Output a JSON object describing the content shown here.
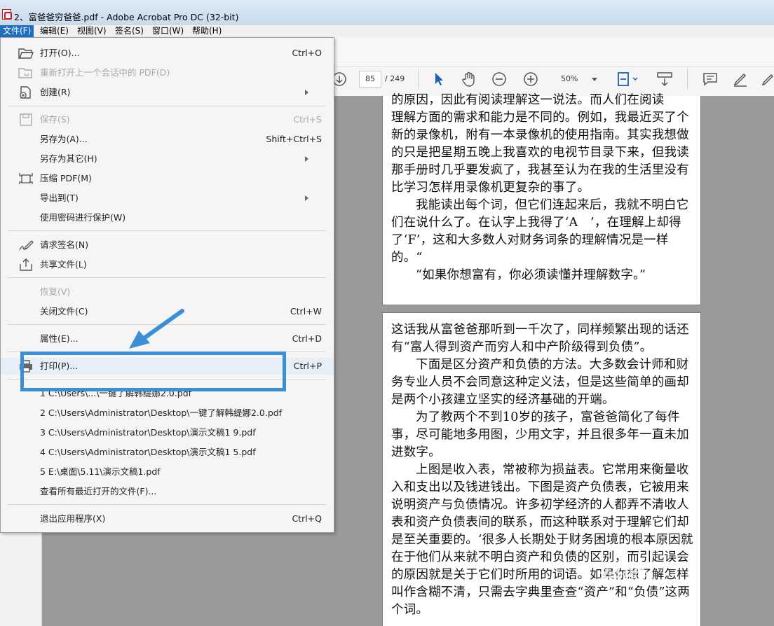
{
  "window": {
    "title": "2、富爸爸穷爸爸.pdf - Adobe Acrobat Pro DC (32-bit)"
  },
  "menubar": [
    "文件(F)",
    "编辑(E)",
    "视图(V)",
    "签名(S)",
    "窗口(W)",
    "帮助(H)"
  ],
  "toolbar": {
    "page_current": "85",
    "page_total": "/ 249",
    "zoom": "50%"
  },
  "file_menu": {
    "open": {
      "label": "打开(O)...",
      "shortcut": "Ctrl+O"
    },
    "reopen": {
      "label": "重新打开上一个会话中的 PDF(D)"
    },
    "create": {
      "label": "创建(R)"
    },
    "save": {
      "label": "保存(S)",
      "shortcut": "Ctrl+S"
    },
    "save_as": {
      "label": "另存为(A)...",
      "shortcut": "Shift+Ctrl+S"
    },
    "save_as_other": {
      "label": "另存为其它(H)"
    },
    "compress": {
      "label": "压缩 PDF(M)"
    },
    "export": {
      "label": "导出到(T)"
    },
    "protect": {
      "label": "使用密码进行保护(W)"
    },
    "request_sign": {
      "label": "请求签名(N)"
    },
    "share": {
      "label": "共享文件(L)"
    },
    "revert": {
      "label": "恢复(V)"
    },
    "close": {
      "label": "关闭文件(C)",
      "shortcut": "Ctrl+W"
    },
    "properties": {
      "label": "属性(E)...",
      "shortcut": "Ctrl+D"
    },
    "print": {
      "label": "打印(P)...",
      "shortcut": "Ctrl+P"
    },
    "recent": [
      "1 C:\\Users\\...\\一键了解韩缇娜2.0.pdf",
      "2 C:\\Users\\Administrator\\Desktop\\一键了解韩缇娜2.0.pdf",
      "3 C:\\Users\\Administrator\\Desktop\\演示文稿1 9.pdf",
      "4 C:\\Users\\Administrator\\Desktop\\演示文稿1 5.pdf",
      "5 E:\\桌面\\5.11\\演示文稿1.pdf"
    ],
    "view_all_recent": {
      "label": "查看所有最近打开的文件(F)..."
    },
    "exit": {
      "label": "退出应用程序(X)",
      "shortcut": "Ctrl+Q"
    }
  },
  "doc": {
    "page1": [
      "的原因，因此有阅读理解这一说法。而人们在阅读",
      "理解方面的需求和能力是不同的。例如，我最近买了个新的录像机，附有一本录像机的使用指南。其实我想做的只是把星期五晚上我喜欢的电视节目录下来，但我读那手册时几乎要发疯了，我甚至认为在我的生活里没有比学习怎样用录像机更复杂的事了。",
      "我能读出每个词，但它们连起来后，我就不明白它们在说什么了。在认字上我得了‘A　’，在理解上却得了‘F’，这和大多数人对财务词条的理解情况是一样的。“",
      "“如果你想富有，你必须读懂并理解数字。”"
    ],
    "page2": [
      "这话我从富爸爸那听到一千次了，同样频繁出现的话还有“富人得到资产而穷人和中产阶级得到负债”。",
      "下面是区分资产和负债的方法。大多数会计师和财务专业人员不会同意这种定义法，但是这些简单的画却是两个小孩建立坚实的经济基础的开端。",
      "为了教两个不到10岁的孩子，富爸爸简化了每件事，尽可能地多用图，少用文字，并且很多年一直未加进数字。",
      "上图是收入表，常被称为损益表。它常用来衡量收入和支出以及钱进钱出。下图是资产负债表，它被用来说明资产与负债情况。许多初学经济的人都弄不清收人表和资产负债表间的联系，而这种联系对于理解它们却是至关重要的。‘很多人长期处于财务困境的根本原因就在于他们从来就不明白资产和负债的区别，而引起误会的原因就是关于它们时所用的词语。如果你想了解怎样叫作含糊不清，只需去字典里查查“资产”和“负债”这两个词。"
    ]
  },
  "watermark": {
    "main": "经验",
    "sub": "com"
  }
}
